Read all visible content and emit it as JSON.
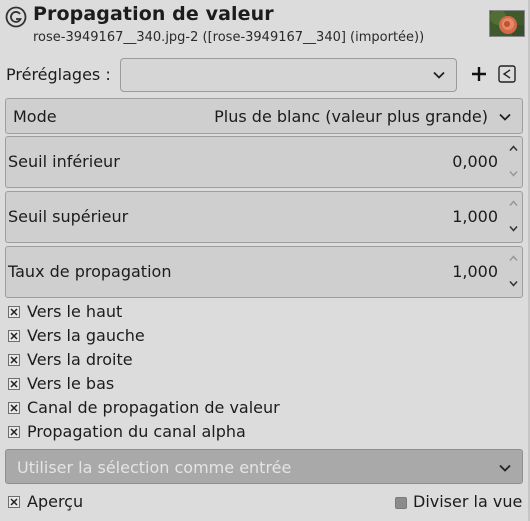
{
  "header": {
    "title": "Propagation de valeur",
    "subtitle": "rose-3949167__340.jpg-2 ([rose-3949167__340] (importée))"
  },
  "presets": {
    "label": "Préréglages :",
    "value": ""
  },
  "mode": {
    "label": "Mode",
    "value": "Plus de blanc (valeur plus grande)"
  },
  "spinners": [
    {
      "label": "Seuil inférieur",
      "value": "0,000"
    },
    {
      "label": "Seuil supérieur",
      "value": "1,000"
    },
    {
      "label": "Taux de propagation",
      "value": "1,000"
    }
  ],
  "checks": [
    {
      "label": "Vers le haut",
      "checked": true
    },
    {
      "label": "Vers la gauche",
      "checked": true
    },
    {
      "label": "Vers la droite",
      "checked": true
    },
    {
      "label": "Vers le bas",
      "checked": true
    },
    {
      "label": "Canal de propagation de valeur",
      "checked": true
    },
    {
      "label": "Propagation du canal alpha",
      "checked": true
    }
  ],
  "selection_input": {
    "label": "Utiliser la sélection comme entrée"
  },
  "footer": {
    "preview_label": "Aperçu",
    "preview_checked": true,
    "split_label": "Diviser la vue",
    "split_checked": false
  }
}
